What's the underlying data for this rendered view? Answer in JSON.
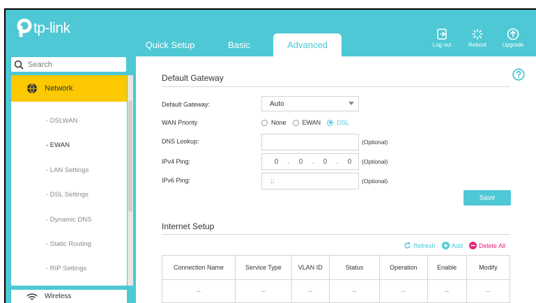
{
  "header": {
    "brand": "tp-link",
    "tabs": [
      {
        "label": "Quick Setup"
      },
      {
        "label": "Basic"
      },
      {
        "label": "Advanced"
      }
    ],
    "actions": [
      {
        "label": "Log out",
        "icon": "logout-icon"
      },
      {
        "label": "Reboot",
        "icon": "reboot-icon"
      },
      {
        "label": "Upgrade",
        "icon": "upgrade-icon"
      }
    ]
  },
  "sidebar": {
    "search_placeholder": "Search",
    "active_group": "Network",
    "items": [
      {
        "label": "- DSLWAN"
      },
      {
        "label": "- EWAN"
      },
      {
        "label": "- LAN Settings"
      },
      {
        "label": "- DSL Settings"
      },
      {
        "label": "- Dynamic DNS"
      },
      {
        "label": "- Static Routing"
      },
      {
        "label": "- RIP Settings"
      }
    ],
    "selected_item": "- EWAN",
    "next_group": "Wireless"
  },
  "gateway": {
    "title": "Default Gateway",
    "fields": {
      "default_gateway_label": "Default Gateway:",
      "default_gateway_value": "Auto",
      "wan_priority_label": "WAN Priority",
      "wan_priority_options": [
        "None",
        "EWAN",
        "DSL"
      ],
      "wan_priority_selected": "DSL",
      "dns_lookup_label": "DNS Lookup:",
      "dns_lookup_value": "",
      "ipv4_ping_label": "IPv4 Ping:",
      "ipv4_ping_octets": [
        "0",
        "0",
        "0",
        "0"
      ],
      "ipv6_ping_label": "IPv6 Ping:",
      "ipv6_ping_value": "::",
      "optional_text": "(Optional)"
    },
    "save_label": "Save"
  },
  "internet": {
    "title": "Internet Setup",
    "refresh_label": "Refresh",
    "add_label": "Add",
    "delete_all_label": "Delete All",
    "columns": [
      "Connection Name",
      "Service Type",
      "VLAN ID",
      "Status",
      "Operation",
      "Enable",
      "Modify"
    ],
    "rows": [
      [
        "--",
        "--",
        "--",
        "--",
        "--",
        "--",
        "--"
      ]
    ]
  },
  "colors": {
    "accent": "#4ec8d4",
    "highlight": "#fcc800",
    "delete": "#e5237a"
  }
}
